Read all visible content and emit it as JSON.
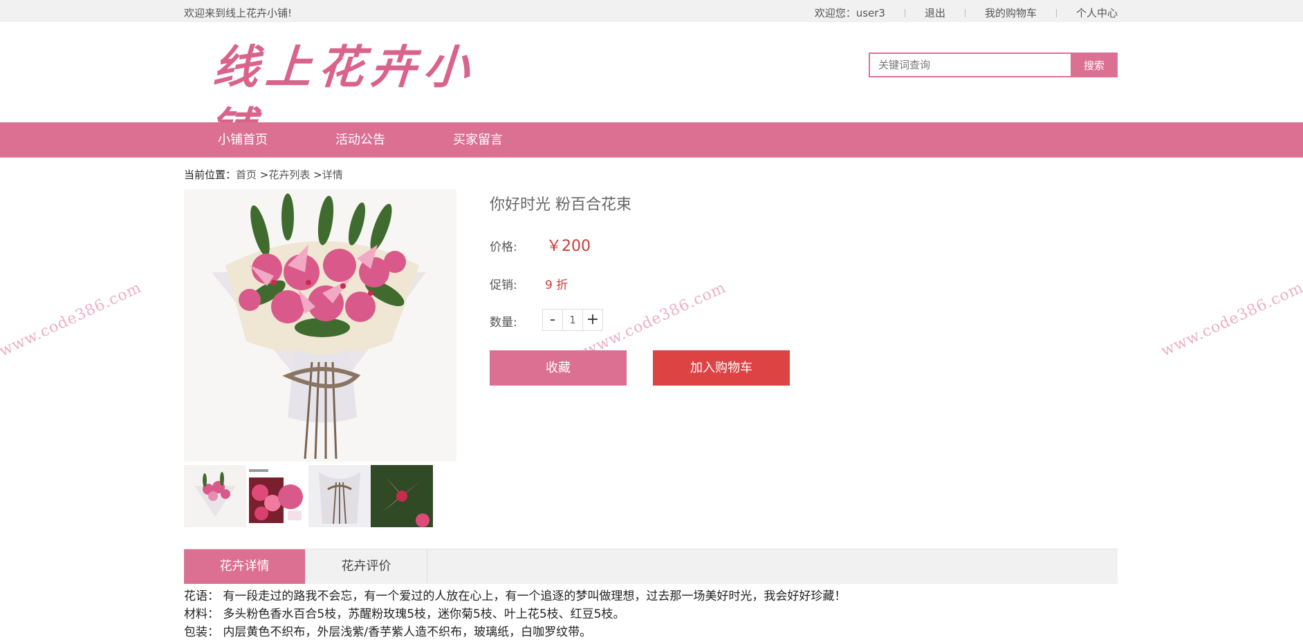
{
  "topbar": {
    "welcome": "欢迎来到线上花卉小铺!",
    "user_greeting": "欢迎您：user3",
    "logout": "退出",
    "cart": "我的购物车",
    "profile": "个人中心"
  },
  "header": {
    "logo_text": "线上花卉小铺",
    "search_placeholder": "关键词查询",
    "search_button": "搜索"
  },
  "nav": {
    "items": [
      {
        "label": "小铺首页"
      },
      {
        "label": "活动公告"
      },
      {
        "label": "买家留言"
      }
    ]
  },
  "breadcrumb": {
    "label": "当前位置：",
    "home": "首页",
    "sep1": " >",
    "list": "花卉列表",
    "sep2": " >",
    "current": "详情"
  },
  "product": {
    "title": "你好时光 粉百合花束",
    "price_label": "价格:",
    "price": "￥200",
    "promo_label": "促销:",
    "promo": "9 折",
    "qty_label": "数量:",
    "qty_minus": "-",
    "qty_value": "1",
    "qty_plus": "+",
    "fav_button": "收藏",
    "cart_button": "加入购物车"
  },
  "tabs": [
    {
      "label": "花卉详情"
    },
    {
      "label": "花卉评价"
    }
  ],
  "description": {
    "line1": "花语： 有一段走过的路我不会忘，有一个爱过的人放在心上，有一个追逐的梦叫做理想，过去那一场美好时光，我会好好珍藏！",
    "line2": "材料： 多头粉色香水百合5枝，苏醒粉玫瑰5枝，迷你菊5枝、叶上花5枝、红豆5枝。",
    "line3": "包装： 内层黄色不织布，外层浅紫/香芋紫人造不织布，玻璃纸，白咖罗纹带。"
  },
  "watermark": "www.code386.com",
  "colors": {
    "accent": "#db7093",
    "cart_red": "#de4343",
    "price_red": "#d03a3a"
  }
}
